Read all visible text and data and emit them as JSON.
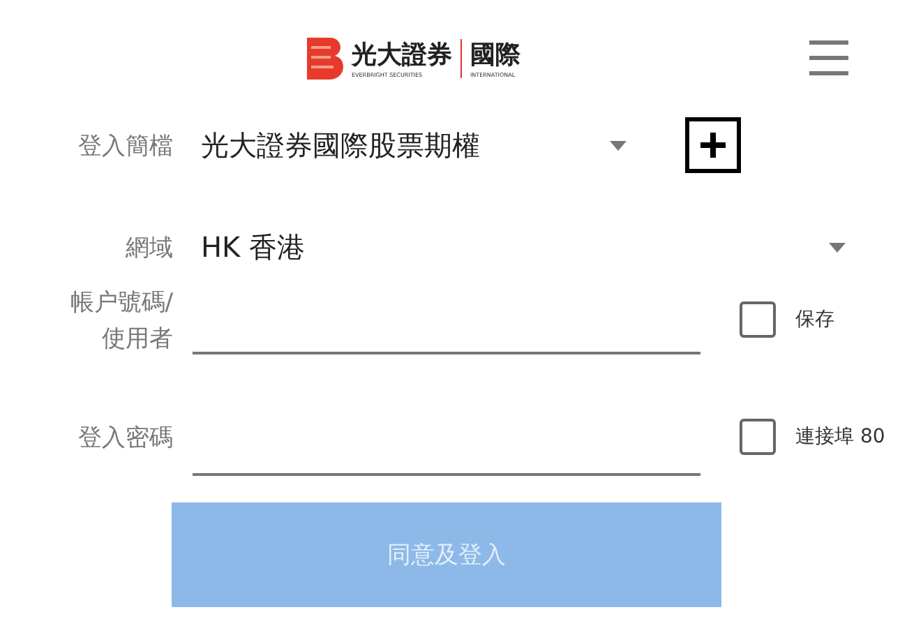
{
  "header": {
    "logo_cn": "光大證券",
    "logo_cn_2": "國際",
    "logo_en": "EVERBRIGHT SECURITIES",
    "logo_en_2": "INTERNATIONAL"
  },
  "profile": {
    "label": "登入簡檔",
    "value": "光大證券國際股票期權"
  },
  "domain": {
    "label": "網域",
    "value": "HK 香港"
  },
  "account": {
    "label": "帳户號碼/\n使用者",
    "save": {
      "label": "保存",
      "checked": false
    }
  },
  "password": {
    "label": "登入密碼",
    "port": {
      "label": "連接埠 80",
      "checked": false
    }
  },
  "login": {
    "label": "同意及登入",
    "disabled": true
  }
}
